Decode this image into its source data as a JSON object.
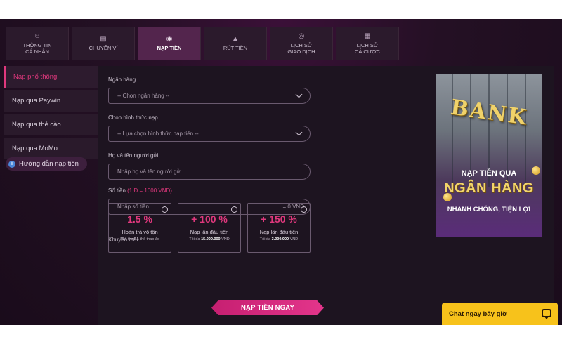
{
  "tabs": [
    {
      "line1": "THÔNG TIN",
      "line2": "CÁ NHÂN",
      "icon": "user-icon",
      "glyph": "☺"
    },
    {
      "line1": "CHUYỂN VÍ",
      "line2": "",
      "icon": "wallet-icon",
      "glyph": "▤"
    },
    {
      "line1": "NẠP TIỀN",
      "line2": "",
      "icon": "deposit-icon",
      "glyph": "◉"
    },
    {
      "line1": "RÚT TIỀN",
      "line2": "",
      "icon": "withdraw-icon",
      "glyph": "▲"
    },
    {
      "line1": "LỊCH SỬ",
      "line2": "GIAO DỊCH",
      "icon": "history-icon",
      "glyph": "◎"
    },
    {
      "line1": "LỊCH SỬ",
      "line2": "CÁ CƯỢC",
      "icon": "bet-history-icon",
      "glyph": "▦"
    }
  ],
  "side_menu": {
    "items": [
      "Nạp phổ thông",
      "Nạp qua Paywin",
      "Nạp qua thẻ cào",
      "Nạp qua MoMo"
    ],
    "guide": "Hướng dẫn nạp tiền"
  },
  "form": {
    "bank_label": "Ngân hàng",
    "bank_value": "-- Chọn ngân hàng --",
    "method_label": "Chọn hình thức nạp",
    "method_value": "-- Lựa chọn hình thức nạp tiền --",
    "sender_label": "Họ và tên người gửi",
    "sender_placeholder": "Nhập họ và tên người gửi",
    "amount_label": "Số tiền",
    "amount_rate": "(1 Đ = 1000 VND)",
    "amount_placeholder": "Nhập số tiền",
    "amount_suffix": "= 0 VND",
    "promo_label": "Khuyến mãi",
    "submit": "NẠP TIỀN NGAY"
  },
  "promos": [
    {
      "pct": "1.5 %",
      "title": "Hoàn trả vô tận",
      "note_pre": "Thể thao & thể thao ảo",
      "note_bold": "",
      "note_post": ""
    },
    {
      "pct": "+ 100 %",
      "title": "Nạp lần đầu tiên",
      "note_pre": "Tối đa ",
      "note_bold": "15.000.000",
      "note_post": " VNĐ"
    },
    {
      "pct": "+ 150 %",
      "title": "Nạp lần đầu tiên",
      "note_pre": "Tối đa ",
      "note_bold": "3.000.000",
      "note_post": " VNĐ"
    }
  ],
  "banner": {
    "bank": "BANK",
    "line1": "NẠP TIỀN QUA",
    "line2": "NGÂN HÀNG",
    "line3": "NHANH CHÓNG, TIỆN LỢI"
  },
  "chat": {
    "label": "Chat ngay bây giờ"
  },
  "colors": {
    "accent": "#e0387d",
    "chat": "#f7c21b",
    "active_tab": "#53254d"
  }
}
